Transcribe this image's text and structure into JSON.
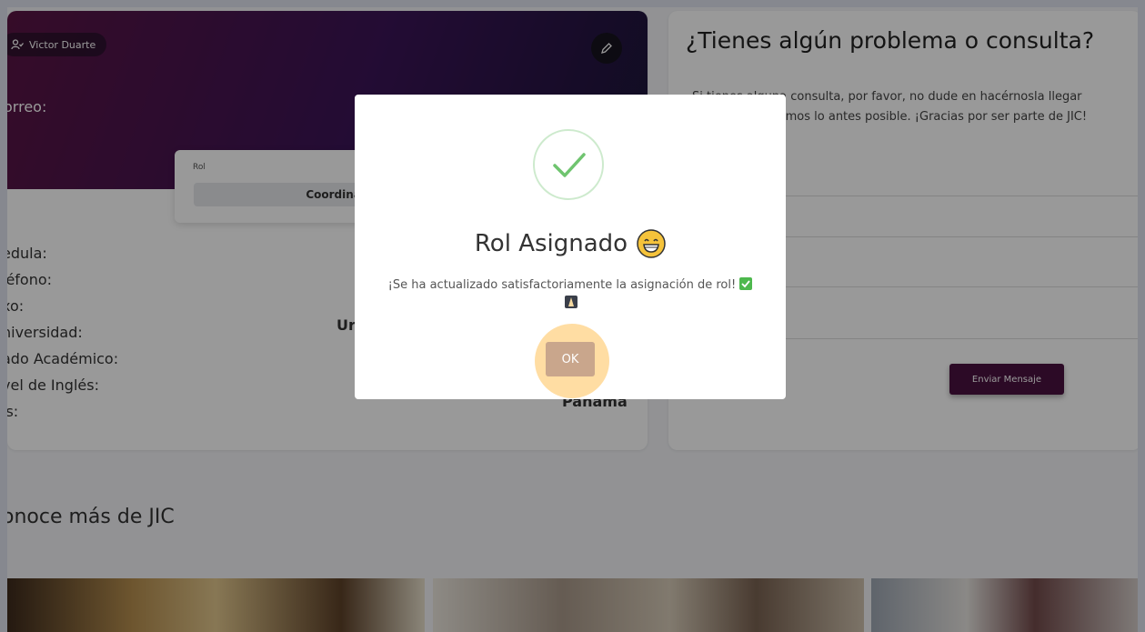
{
  "profile": {
    "user_name": "Victor Duarte",
    "email_label": "orreo:",
    "rol_label": "Rol",
    "rol_value": "Coordinador",
    "fields": [
      "edula:",
      "léfono:",
      "xo:",
      "niversidad:",
      "ado Académico:",
      "vel de Inglés:",
      "ís:"
    ],
    "university_value": "Ur",
    "country_value": "Panama"
  },
  "contact": {
    "title": "¿Tienes algún problema o consulta?",
    "text_line1": "Si tienes alguna consulta, por favor, no dude en hacérnosla llegar",
    "text_line2": "y te responderemos lo antes posible. ¡Gracias por ser parte de JIC!",
    "send_label": "Enviar Mensaje"
  },
  "section": {
    "title": "onoce más de JIC"
  },
  "modal": {
    "title": "Rol Asignado",
    "message": "¡Se ha actualizado satisfactoriamente la asignación de rol!",
    "ok_label": "OK"
  },
  "colors": {
    "accent": "#4a1240",
    "success": "#6fc46f",
    "ok_button": "#c9a68c"
  },
  "icons": [
    "user-check-icon",
    "pencil-icon",
    "success-check-icon",
    "grin-emoji-icon",
    "check-emoji-icon",
    "pray-emoji-icon"
  ]
}
